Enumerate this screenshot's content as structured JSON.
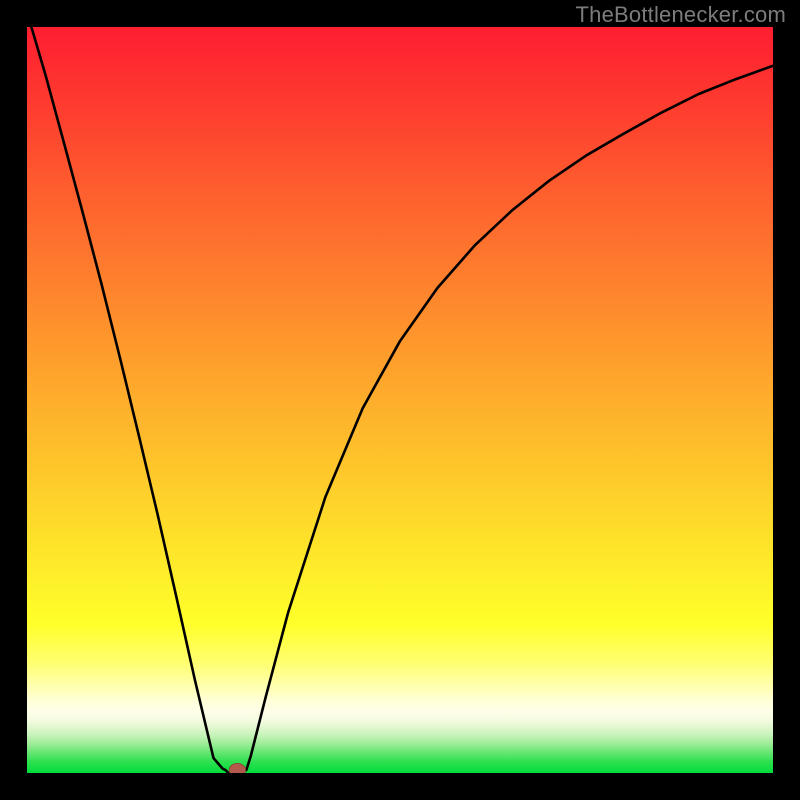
{
  "watermark": "TheBottlenecker.com",
  "colors": {
    "black": "#000000",
    "watermark": "#7c7c7c",
    "curve": "#000000",
    "marker_fill": "#b45a4d",
    "marker_stroke": "#8d4238"
  },
  "gradient_stops": [
    {
      "offset": 0.0,
      "color": "#fe1e30"
    },
    {
      "offset": 0.1,
      "color": "#fe3a2f"
    },
    {
      "offset": 0.22,
      "color": "#fe5e2e"
    },
    {
      "offset": 0.35,
      "color": "#fe832d"
    },
    {
      "offset": 0.48,
      "color": "#fea82c"
    },
    {
      "offset": 0.6,
      "color": "#fec92b"
    },
    {
      "offset": 0.72,
      "color": "#feea2a"
    },
    {
      "offset": 0.8,
      "color": "#ffff2a"
    },
    {
      "offset": 0.852,
      "color": "#ffff70"
    },
    {
      "offset": 0.884,
      "color": "#ffffb0"
    },
    {
      "offset": 0.903,
      "color": "#ffffd8"
    },
    {
      "offset": 0.918,
      "color": "#fefee8"
    },
    {
      "offset": 0.93,
      "color": "#f3fbdf"
    },
    {
      "offset": 0.945,
      "color": "#d3f5c3"
    },
    {
      "offset": 0.958,
      "color": "#a8eea0"
    },
    {
      "offset": 0.97,
      "color": "#72e77a"
    },
    {
      "offset": 0.985,
      "color": "#2ee050"
    },
    {
      "offset": 1.0,
      "color": "#03dd3a"
    }
  ],
  "chart_data": {
    "type": "line",
    "x": [
      0.0,
      0.025,
      0.05,
      0.075,
      0.1,
      0.125,
      0.15,
      0.175,
      0.2,
      0.225,
      0.25,
      0.262,
      0.266,
      0.27,
      0.275,
      0.28,
      0.286,
      0.294,
      0.3,
      0.32,
      0.35,
      0.4,
      0.45,
      0.5,
      0.55,
      0.6,
      0.65,
      0.7,
      0.75,
      0.8,
      0.85,
      0.9,
      0.95,
      1.0
    ],
    "values": [
      1.02,
      0.935,
      0.843,
      0.75,
      0.655,
      0.555,
      0.452,
      0.347,
      0.237,
      0.125,
      0.02,
      0.006,
      0.004,
      0.0,
      0.0,
      0.004,
      0.004,
      0.004,
      0.023,
      0.102,
      0.215,
      0.37,
      0.489,
      0.579,
      0.65,
      0.707,
      0.754,
      0.794,
      0.828,
      0.857,
      0.885,
      0.91,
      0.93,
      0.948
    ],
    "marker": {
      "x": 0.282,
      "y": 0.004,
      "rx": 0.011,
      "ry": 0.0088
    },
    "title": "",
    "xlabel": "",
    "ylabel": "",
    "xlim": [
      0,
      1
    ],
    "ylim": [
      0,
      1
    ]
  }
}
